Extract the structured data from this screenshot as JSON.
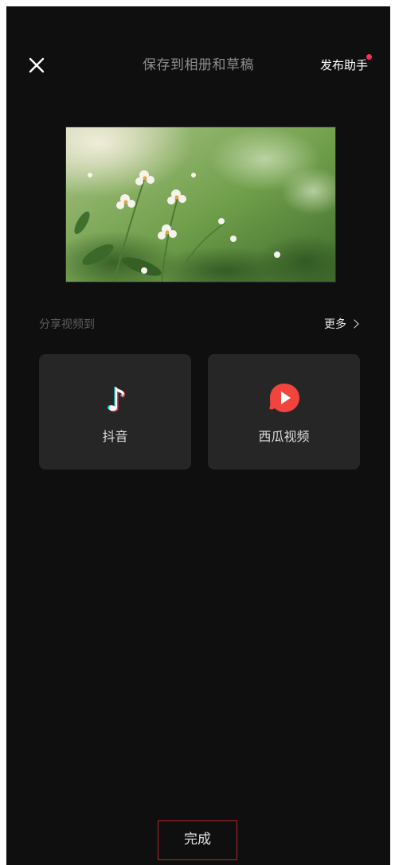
{
  "header": {
    "close_icon": "close-icon",
    "title": "保存到相册和草稿",
    "assistant_label": "发布助手"
  },
  "preview": {
    "icon": "video-thumbnail"
  },
  "share": {
    "label": "分享视频到",
    "more_label": "更多",
    "targets": [
      {
        "label": "抖音",
        "icon": "douyin-icon"
      },
      {
        "label": "西瓜视频",
        "icon": "xigua-video-icon"
      }
    ]
  },
  "footer": {
    "done_label": "完成"
  },
  "colors": {
    "background": "#0f0f0f",
    "card": "#262626",
    "notification_dot": "#ff2d55",
    "done_border": "#b3262b",
    "xigua_red": "#f0443c"
  }
}
